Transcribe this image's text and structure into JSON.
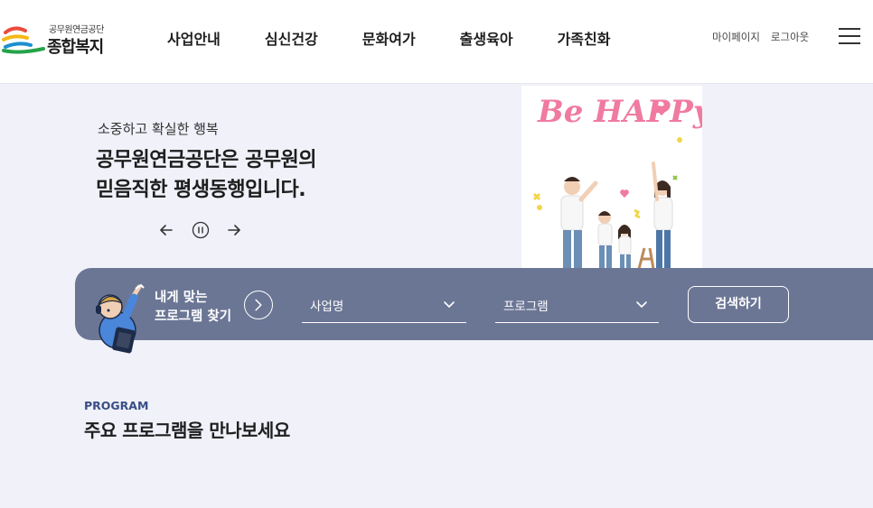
{
  "header": {
    "logo_sub": "공무원연금공단",
    "logo_main": "종합복지",
    "nav": [
      "사업안내",
      "심신건강",
      "문화여가",
      "출생육아",
      "가족친화"
    ],
    "util": [
      "마이페이지",
      "로그아웃"
    ]
  },
  "hero": {
    "eyebrow": "소중하고 확실한 행복",
    "title_line1": "공무원연금공단은 공무원의",
    "title_line2": "믿음직한 평생동행입니다.",
    "image_text": "Be HAPPy"
  },
  "finder": {
    "title_line1": "내게 맞는",
    "title_line2": "프로그램 찾기",
    "select1_value": "사업명",
    "select2_value": "프로그램",
    "search_label": "검색하기"
  },
  "program": {
    "eyebrow": "PROGRAM",
    "title": "주요 프로그램을 만나보세요"
  },
  "colors": {
    "page_bg": "#f0f1f9",
    "finder_bg": "#6b7695",
    "accent_pink": "#f07aa0",
    "program_eyebrow": "#3a4e86"
  }
}
